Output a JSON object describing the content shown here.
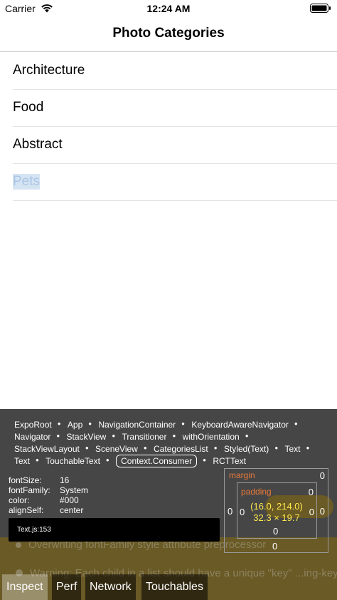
{
  "status_bar": {
    "carrier": "Carrier",
    "time": "12:24 AM"
  },
  "nav": {
    "title": "Photo Categories"
  },
  "categories": [
    {
      "label": "Architecture"
    },
    {
      "label": "Food"
    },
    {
      "label": "Abstract"
    },
    {
      "label": "Pets"
    }
  ],
  "inspector": {
    "breadcrumbs": [
      "ExpoRoot",
      "App",
      "NavigationContainer",
      "KeyboardAwareNavigator",
      "Navigator",
      "StackView",
      "Transitioner",
      "withOrientation",
      "StackViewLayout",
      "SceneView",
      "CategoriesList",
      "Styled(Text)",
      "Text",
      "Text",
      "TouchableText",
      "Context.Consumer",
      "RCTText"
    ],
    "selected_crumb": "Context.Consumer",
    "props": [
      {
        "key": "fontSize:",
        "value": "16"
      },
      {
        "key": "fontFamily:",
        "value": "System"
      },
      {
        "key": "color:",
        "value": "#000"
      },
      {
        "key": "alignSelf:",
        "value": "center"
      }
    ],
    "source": "Text.js:153",
    "box_model": {
      "margin_label": "margin",
      "padding_label": "padding",
      "margin_top": "0",
      "margin_left": "0",
      "margin_right": "0",
      "margin_bottom": "0",
      "padding_top": "0",
      "padding_left": "0",
      "padding_right": "0",
      "padding_bottom": "0",
      "position": "(16.0, 214.0)",
      "size": "32.3 × 19.7"
    },
    "warnings": [
      "Overwriting fontFamily style attribute preprocessor",
      "Warning: Each child in a list should have a unique \"key\" ...ing-keys for more in..."
    ],
    "tabs": [
      {
        "label": "Inspect",
        "active": true
      },
      {
        "label": "Perf",
        "active": false
      },
      {
        "label": "Network",
        "active": false
      },
      {
        "label": "Touchables",
        "active": false
      }
    ]
  },
  "colors": {
    "accent_orange": "#e8793a",
    "dimension_yellow": "#ffe84a",
    "selected_item_highlight": "#d5e4f3"
  }
}
